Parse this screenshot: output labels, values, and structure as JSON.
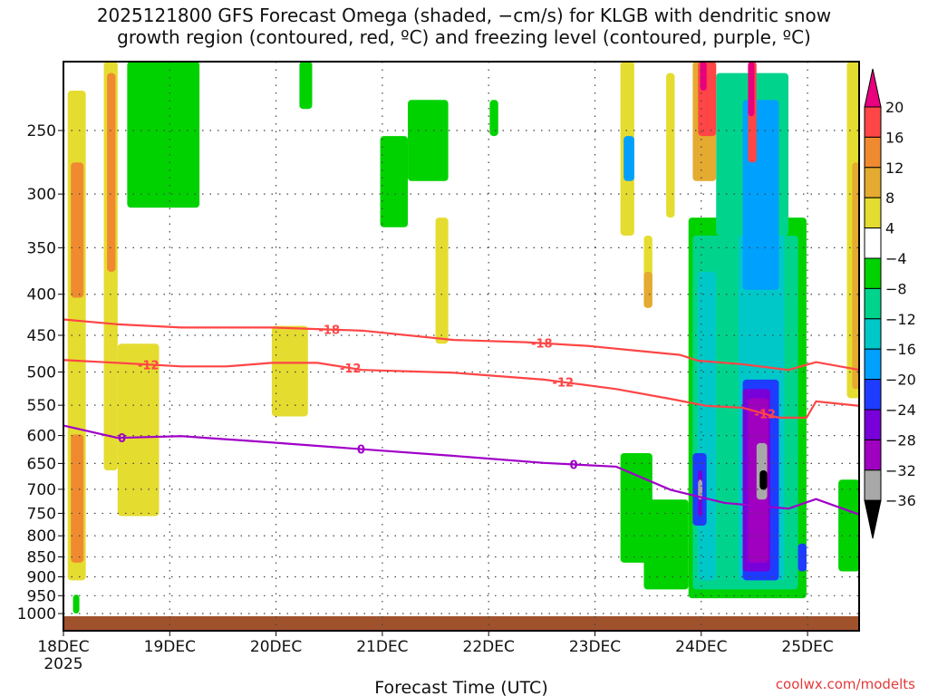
{
  "chart_data": {
    "type": "heatmap",
    "title_line1": "2025121800 GFS Forecast Omega (shaded, −cm/s) for KLGB with dendritic snow",
    "title_line2": "growth region (contoured, red, ºC) and freezing level (contoured, purple, ºC)",
    "xlabel": "Forecast Time (UTC)",
    "credit": "coolwx.com/modelts",
    "x_unit": "days since 2025-12-18 00Z",
    "xlim": [
      0,
      7.49
    ],
    "ylim_hPa": [
      205,
      1050
    ],
    "y_scale": "log",
    "x_ticks": [
      {
        "t": 0,
        "label": "18DEC",
        "sub": "2025"
      },
      {
        "t": 1,
        "label": "19DEC"
      },
      {
        "t": 2,
        "label": "20DEC"
      },
      {
        "t": 3,
        "label": "21DEC"
      },
      {
        "t": 4,
        "label": "22DEC"
      },
      {
        "t": 5,
        "label": "23DEC"
      },
      {
        "t": 6,
        "label": "24DEC"
      },
      {
        "t": 7,
        "label": "25DEC"
      }
    ],
    "y_ticks": [
      250,
      300,
      350,
      400,
      450,
      500,
      550,
      600,
      650,
      700,
      750,
      800,
      850,
      900,
      950,
      1000
    ],
    "colorbar": {
      "labels": [
        "20",
        "16",
        "12",
        "8",
        "4",
        "−4",
        "−8",
        "−12",
        "−16",
        "−20",
        "−24",
        "−28",
        "−32",
        "−36"
      ],
      "colors": [
        "#e8007f",
        "#ff4545",
        "#f08a30",
        "#e5aa30",
        "#e5dc30",
        "#ffffff",
        "#00d200",
        "#00d48c",
        "#00c8c8",
        "#00a0ff",
        "#1e3cff",
        "#7800d8",
        "#a000c0",
        "#a8a8a8",
        "#000000"
      ]
    },
    "ground_color": "#a0522d",
    "regions_note": "[t0, t1, p_top_hPa, p_bottom_hPa, omega]",
    "regions": [
      [
        0.04,
        0.21,
        223,
        909,
        6
      ],
      [
        0.07,
        0.19,
        274,
        404,
        14
      ],
      [
        0.07,
        0.19,
        598,
        864,
        14
      ],
      [
        0.38,
        0.51,
        205,
        663,
        6
      ],
      [
        0.41,
        0.49,
        212,
        375,
        14
      ],
      [
        0.51,
        0.9,
        461,
        756,
        6
      ],
      [
        0.6,
        1.28,
        205,
        312,
        -6
      ],
      [
        1.96,
        2.3,
        438,
        568,
        6
      ],
      [
        2.22,
        2.34,
        205,
        235,
        -6
      ],
      [
        2.98,
        3.24,
        254,
        330,
        -6
      ],
      [
        3.24,
        3.62,
        229,
        289,
        -6
      ],
      [
        3.5,
        3.62,
        321,
        461,
        6
      ],
      [
        4.01,
        4.09,
        229,
        254,
        -6
      ],
      [
        0.09,
        0.15,
        947,
        1000,
        -6
      ],
      [
        5.24,
        5.37,
        205,
        338,
        6
      ],
      [
        5.27,
        5.37,
        254,
        289,
        -18
      ],
      [
        5.67,
        5.75,
        212,
        321,
        6
      ],
      [
        5.46,
        5.54,
        338,
        416,
        6
      ],
      [
        5.46,
        5.54,
        375,
        416,
        10
      ],
      [
        5.24,
        5.54,
        631,
        864,
        -6
      ],
      [
        5.46,
        5.88,
        721,
        933,
        -6
      ],
      [
        5.88,
        6.99,
        321,
        957,
        -6
      ],
      [
        5.92,
        6.91,
        338,
        933,
        -10
      ],
      [
        5.97,
        6.14,
        375,
        909,
        -14
      ],
      [
        6.35,
        6.78,
        289,
        909,
        -14
      ],
      [
        6.14,
        6.82,
        212,
        338,
        -10
      ],
      [
        6.39,
        6.73,
        229,
        395,
        -18
      ],
      [
        6.39,
        6.73,
        511,
        909,
        -22
      ],
      [
        6.39,
        6.65,
        525,
        886,
        -26
      ],
      [
        6.44,
        6.63,
        539,
        864,
        -30
      ],
      [
        6.52,
        6.62,
        613,
        721,
        -34
      ],
      [
        6.55,
        6.62,
        663,
        701,
        -40
      ],
      [
        5.92,
        6.05,
        631,
        777,
        -22
      ],
      [
        5.97,
        6.01,
        663,
        756,
        -26
      ],
      [
        5.97,
        6.01,
        681,
        721,
        -34
      ],
      [
        5.92,
        6.14,
        205,
        289,
        10
      ],
      [
        5.97,
        6.14,
        205,
        254,
        18
      ],
      [
        5.99,
        6.05,
        205,
        223,
        22
      ],
      [
        6.44,
        6.52,
        205,
        274,
        18
      ],
      [
        6.44,
        6.5,
        205,
        240,
        22
      ],
      [
        7.37,
        7.49,
        205,
        539,
        6
      ],
      [
        7.42,
        7.49,
        274,
        525,
        10
      ],
      [
        7.29,
        7.49,
        681,
        886,
        -6
      ],
      [
        6.91,
        6.99,
        818,
        886,
        -22
      ]
    ],
    "contours": [
      {
        "label": "-18",
        "color": "#ff4545",
        "label_at": [
          2.5,
          4.5
        ],
        "points": [
          [
            0,
            430
          ],
          [
            0.51,
            436
          ],
          [
            1.11,
            440
          ],
          [
            1.96,
            440
          ],
          [
            2.81,
            444
          ],
          [
            3.67,
            456
          ],
          [
            4.35,
            459
          ],
          [
            4.94,
            464
          ],
          [
            5.8,
            476
          ],
          [
            5.97,
            484
          ],
          [
            6.39,
            489
          ],
          [
            6.82,
            497
          ],
          [
            7.08,
            486
          ],
          [
            7.49,
            497
          ]
        ]
      },
      {
        "label": "-12",
        "color": "#ff4545",
        "label_at": [
          0.8,
          2.7,
          4.7,
          6.6
        ],
        "points": [
          [
            0,
            483
          ],
          [
            0.51,
            487
          ],
          [
            1.11,
            492
          ],
          [
            1.53,
            492
          ],
          [
            1.96,
            487
          ],
          [
            2.39,
            487
          ],
          [
            2.81,
            497
          ],
          [
            3.67,
            501
          ],
          [
            4.52,
            511
          ],
          [
            5.2,
            525
          ],
          [
            5.71,
            540
          ],
          [
            6.05,
            551
          ],
          [
            6.39,
            554
          ],
          [
            6.73,
            570
          ],
          [
            6.99,
            570
          ],
          [
            7.08,
            544
          ],
          [
            7.49,
            551
          ]
        ]
      },
      {
        "label": "0",
        "color": "#a000c8",
        "label_at": [
          0.55,
          2.8,
          4.8
        ],
        "points": [
          [
            0,
            583
          ],
          [
            0.51,
            604
          ],
          [
            1.11,
            601
          ],
          [
            1.96,
            612
          ],
          [
            2.81,
            624
          ],
          [
            3.67,
            636
          ],
          [
            4.52,
            649
          ],
          [
            5.2,
            656
          ],
          [
            5.71,
            701
          ],
          [
            6.22,
            728
          ],
          [
            6.82,
            740
          ],
          [
            7.08,
            720
          ],
          [
            7.49,
            753
          ]
        ]
      }
    ]
  }
}
